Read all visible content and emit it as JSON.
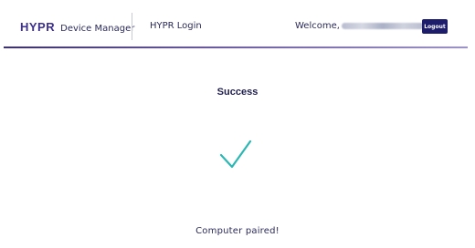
{
  "header": {
    "brand_logo": "HYPR",
    "brand_sub": "Device Manager",
    "nav_link": "HYPR Login",
    "welcome_label": "Welcome,",
    "logout_label": "Logout"
  },
  "main": {
    "title": "Success",
    "status_icon": "checkmark-icon",
    "message": "Computer  paired!"
  },
  "colors": {
    "brand": "#3d2f8f",
    "logout_bg": "#1e1d6b",
    "check": "#2bb7b3"
  }
}
